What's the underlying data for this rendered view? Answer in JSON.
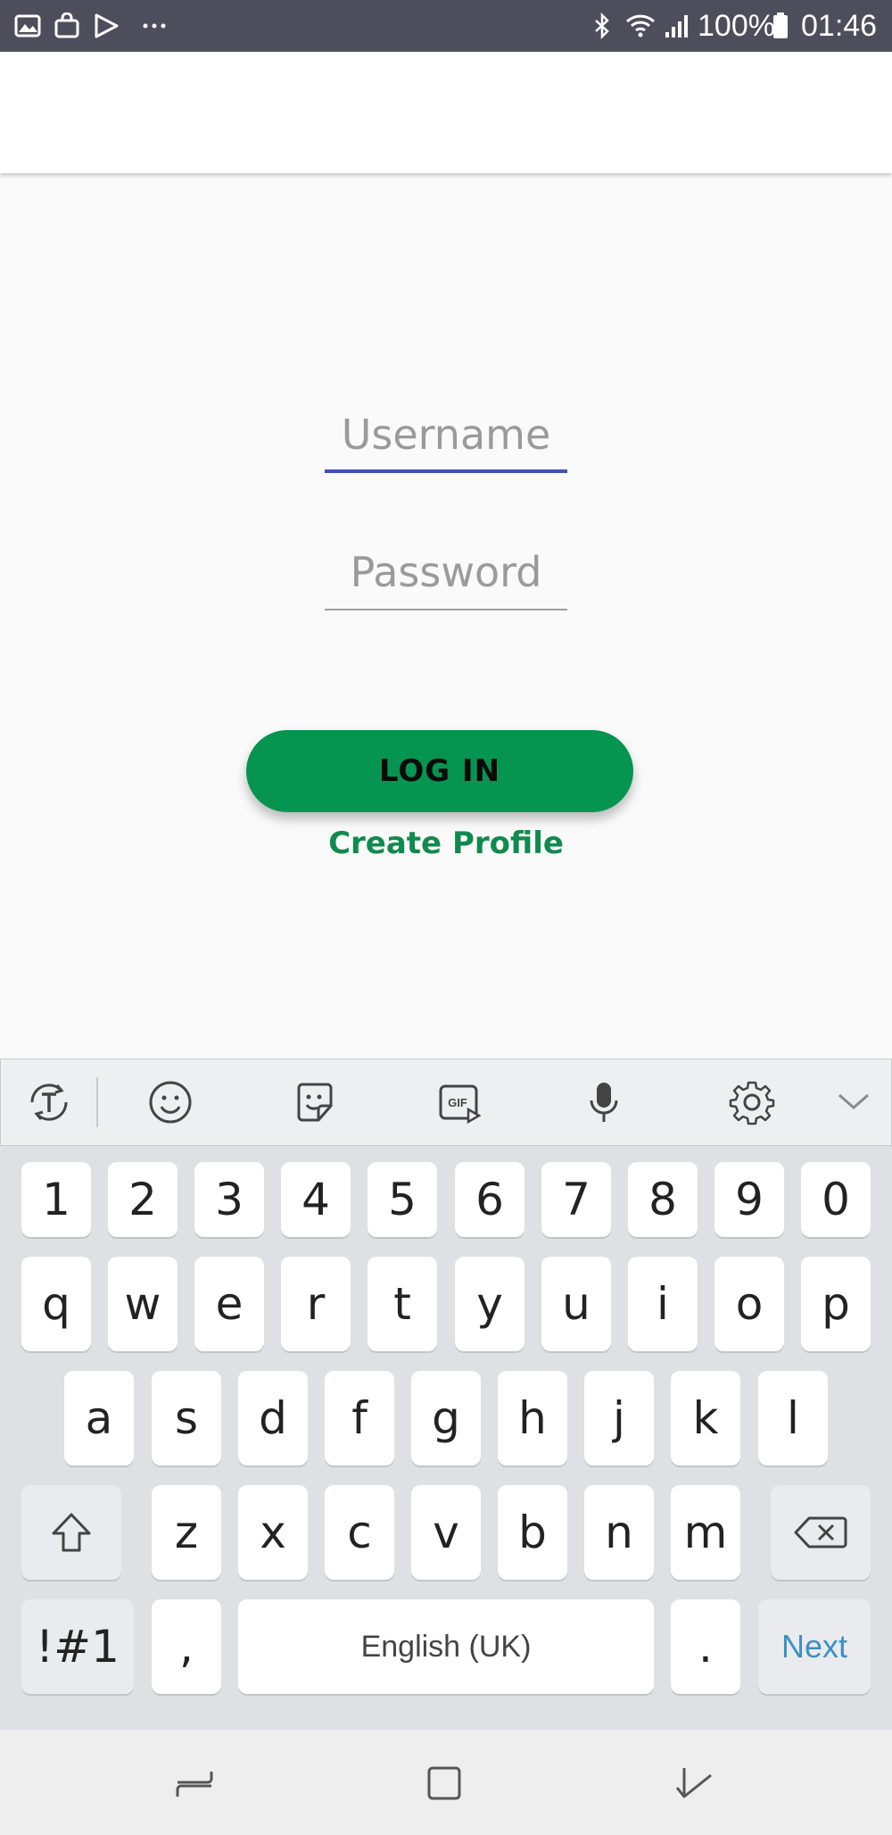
{
  "status_bar": {
    "battery": "100%",
    "time": "01:46",
    "left_icons": [
      "gallery-icon",
      "shopping-bag-icon",
      "play-store-icon",
      "more-dots-icon"
    ],
    "right_icons": [
      "bluetooth-icon",
      "wifi-icon",
      "signal-icon",
      "battery-icon"
    ]
  },
  "login_form": {
    "username_placeholder": "Username",
    "password_placeholder": "Password",
    "login_label": "LOG IN",
    "create_profile_label": "Create Profile"
  },
  "keyboard": {
    "toolbar": [
      "translate-icon",
      "emoji-icon",
      "sticker-icon",
      "gif-icon",
      "microphone-icon",
      "settings-icon",
      "chevron-down-icon"
    ],
    "number_row": [
      "1",
      "2",
      "3",
      "4",
      "5",
      "6",
      "7",
      "8",
      "9",
      "0"
    ],
    "row1": [
      "q",
      "w",
      "e",
      "r",
      "t",
      "y",
      "u",
      "i",
      "o",
      "p"
    ],
    "row2": [
      "a",
      "s",
      "d",
      "f",
      "g",
      "h",
      "j",
      "k",
      "l"
    ],
    "row3": [
      "z",
      "x",
      "c",
      "v",
      "b",
      "n",
      "m"
    ],
    "symbols_label": "!#1",
    "comma_label": ",",
    "space_label": "English (UK)",
    "period_label": ".",
    "next_label": "Next"
  },
  "nav_bar": {
    "icons": [
      "recent-apps-icon",
      "home-icon",
      "back-icon"
    ]
  },
  "colors": {
    "status_bar": "#4c4f5b",
    "accent_green": "#069550",
    "link_green": "#118a4f",
    "focus_underline": "#3f51b5",
    "next_key": "#3d90c4"
  }
}
